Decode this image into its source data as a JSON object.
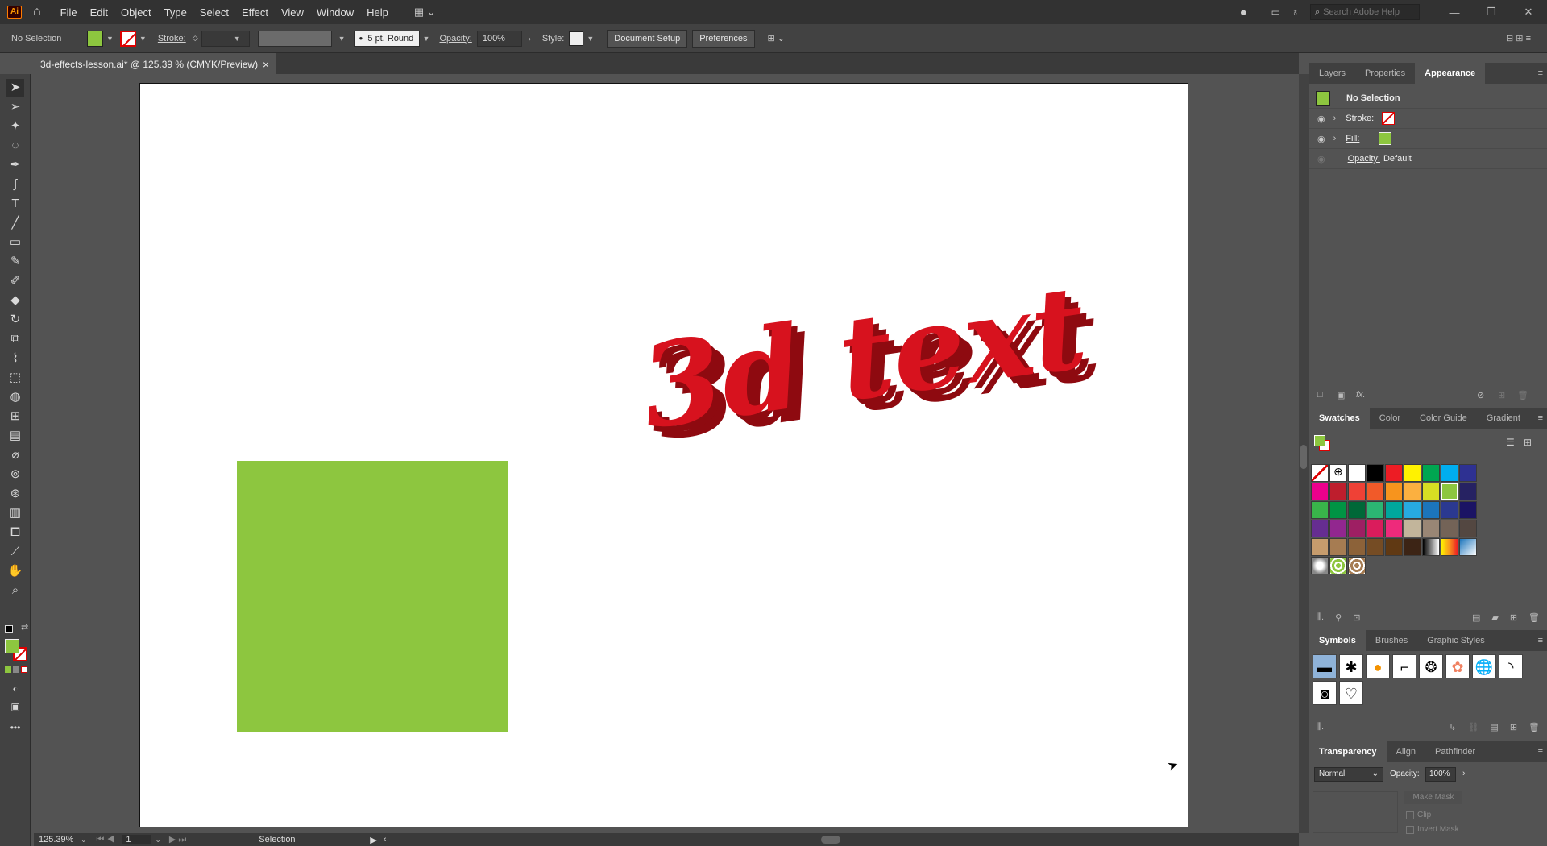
{
  "app": {
    "logo": "Ai"
  },
  "menu": [
    "File",
    "Edit",
    "Object",
    "Type",
    "Select",
    "Effect",
    "View",
    "Window",
    "Help"
  ],
  "search": {
    "placeholder": "Search Adobe Help"
  },
  "control": {
    "selection": "No Selection",
    "stroke_label": "Stroke:",
    "brush": "5 pt. Round",
    "opacity_label": "Opacity:",
    "opacity_value": "100%",
    "style_label": "Style:",
    "doc_setup": "Document Setup",
    "preferences": "Preferences"
  },
  "document": {
    "tab_title": "3d-effects-lesson.ai* @ 125.39 % (CMYK/Preview)",
    "close": "×"
  },
  "artwork": {
    "text_3d": "3d text",
    "colors": {
      "text_face": "#d7121e",
      "text_extrude": "#8e0a10",
      "rect": "#8dc63f"
    }
  },
  "appearance": {
    "tabs": [
      "Layers",
      "Properties",
      "Appearance"
    ],
    "title": "No Selection",
    "stroke": "Stroke:",
    "fill": "Fill:",
    "opacity_label": "Opacity:",
    "opacity_value": "Default"
  },
  "swatches": {
    "tabs": [
      "Swatches",
      "Color",
      "Color Guide",
      "Gradient"
    ]
  },
  "symbols": {
    "tabs": [
      "Symbols",
      "Brushes",
      "Graphic Styles"
    ]
  },
  "transparency": {
    "tabs": [
      "Transparency",
      "Align",
      "Pathfinder"
    ],
    "blend_mode": "Normal",
    "opacity_label": "Opacity:",
    "opacity_value": "100%",
    "make_mask": "Make Mask",
    "clip": "Clip",
    "invert_mask": "Invert Mask"
  },
  "status": {
    "zoom": "125.39%",
    "artboard": "1",
    "tool": "Selection"
  }
}
